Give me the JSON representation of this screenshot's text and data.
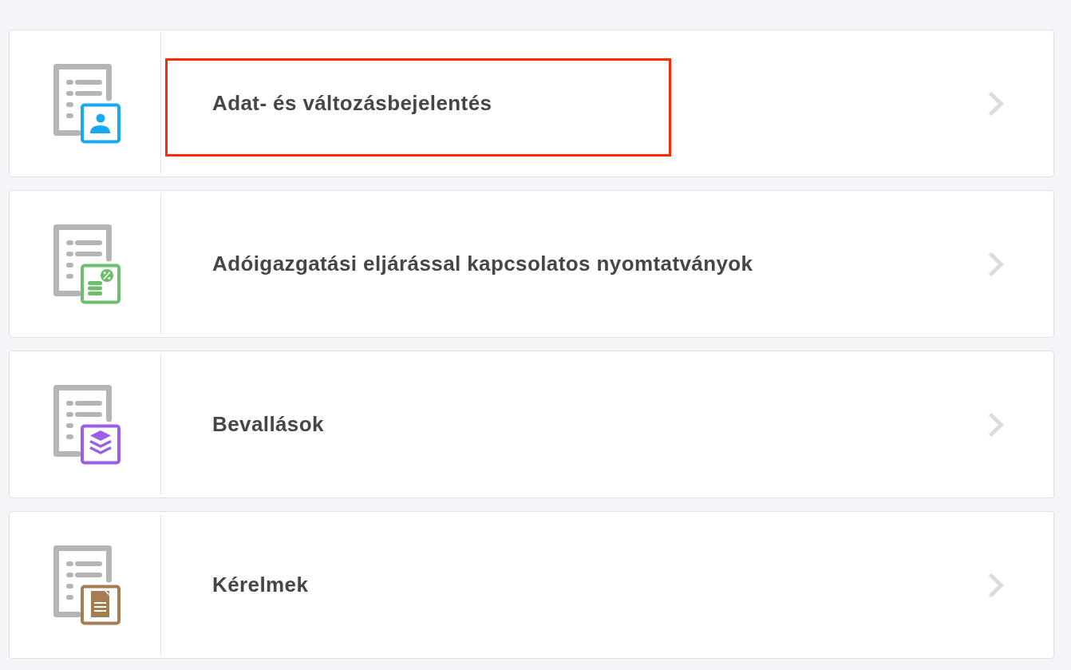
{
  "items": [
    {
      "title": "Adat- és változásbejelentés",
      "kind": "person",
      "color": "#18a9f4",
      "highlighted": true
    },
    {
      "title": "Adóigazgatási eljárással kapcsolatos nyomtatványok",
      "kind": "coins",
      "color": "#6cbd6c",
      "highlighted": false
    },
    {
      "title": "Bevallások",
      "kind": "layers",
      "color": "#9b5ee8",
      "highlighted": false
    },
    {
      "title": "Kérelmek",
      "kind": "document",
      "color": "#a67c52",
      "highlighted": false
    }
  ]
}
